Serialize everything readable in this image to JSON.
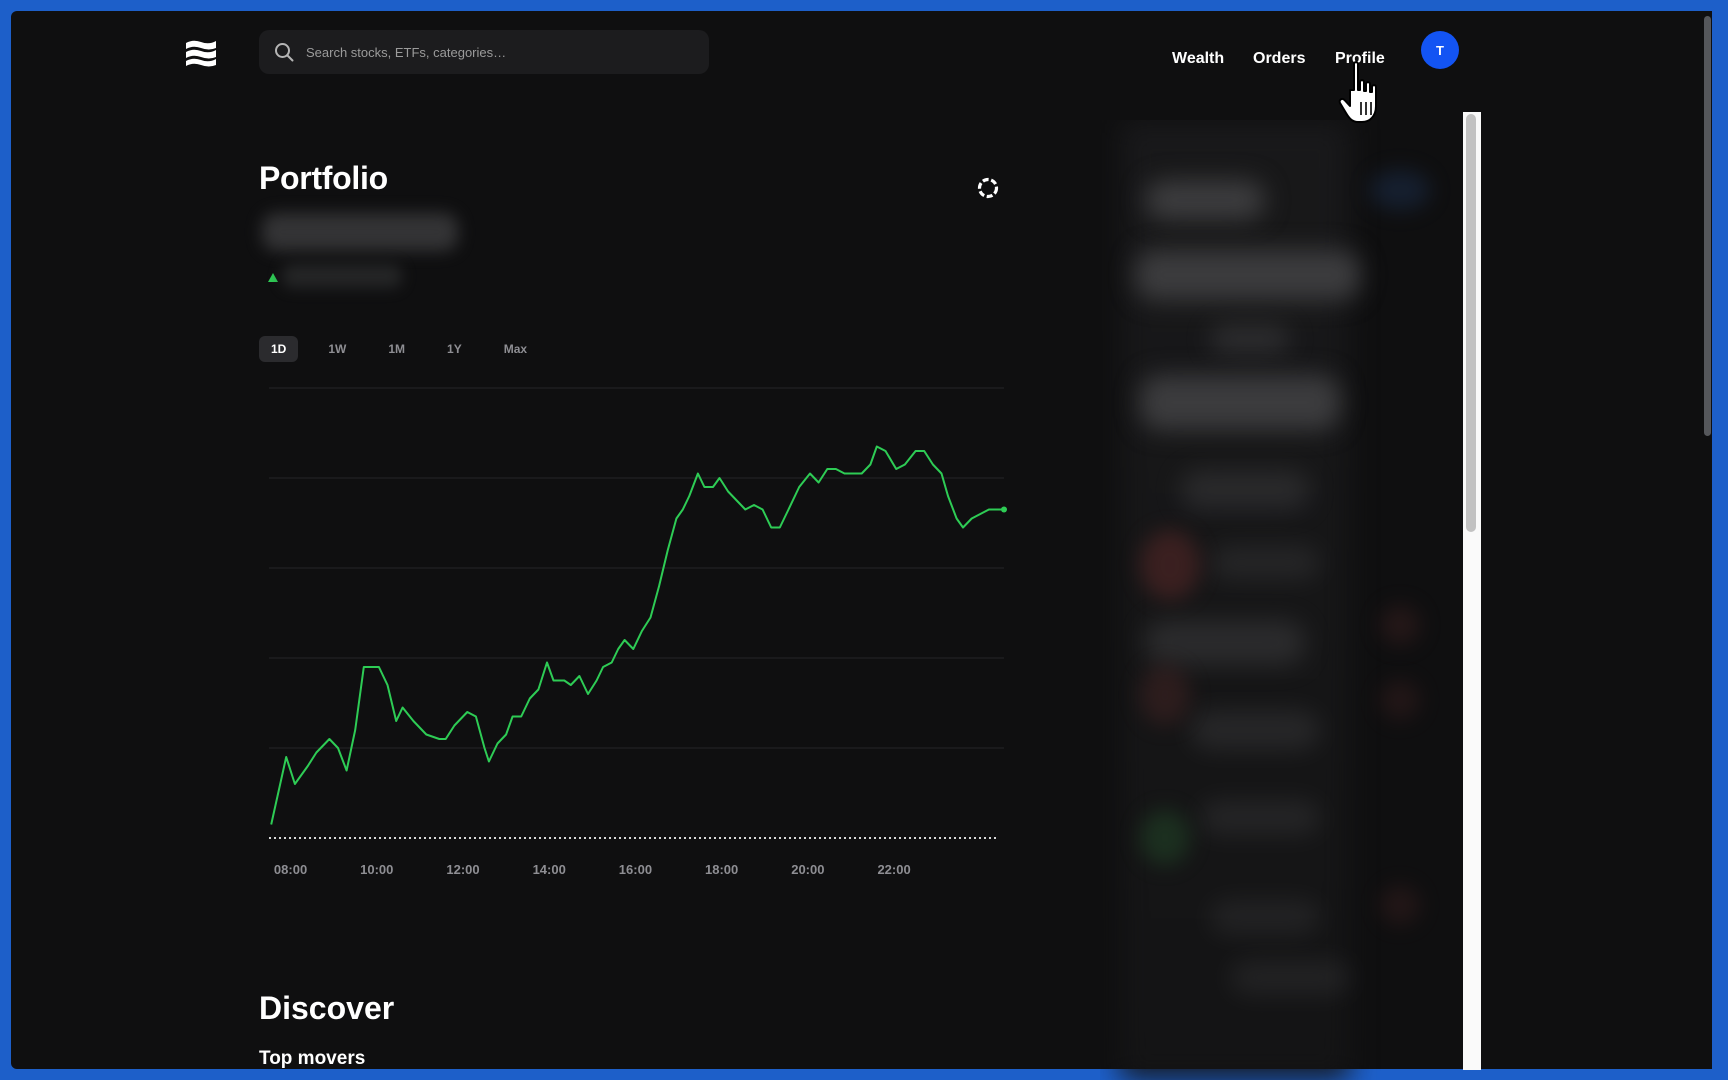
{
  "header": {
    "search_placeholder": "Search stocks, ETFs, categories…",
    "nav": [
      "Wealth",
      "Orders",
      "Profile"
    ],
    "avatar_initial": "T"
  },
  "portfolio": {
    "title": "Portfolio",
    "ranges": [
      "1D",
      "1W",
      "1M",
      "1Y",
      "Max"
    ],
    "active_range": "1D"
  },
  "chart_data": {
    "type": "line",
    "line_color": "#2ecc55",
    "x_tick_labels": [
      "08:00",
      "10:00",
      "12:00",
      "14:00",
      "16:00",
      "18:00",
      "20:00",
      "22:00"
    ],
    "x_range_hours": [
      7.5,
      23.0
    ],
    "grid": "horizontal",
    "baseline": "dotted",
    "y_normalized_note": "",
    "series": [
      {
        "values": [
          [
            7.55,
            0.03
          ],
          [
            7.9,
            0.18
          ],
          [
            8.1,
            0.12
          ],
          [
            8.4,
            0.16
          ],
          [
            8.6,
            0.19
          ],
          [
            8.9,
            0.22
          ],
          [
            9.1,
            0.2
          ],
          [
            9.3,
            0.15
          ],
          [
            9.5,
            0.24
          ],
          [
            9.7,
            0.38
          ],
          [
            10.05,
            0.38
          ],
          [
            10.25,
            0.34
          ],
          [
            10.45,
            0.26
          ],
          [
            10.6,
            0.29
          ],
          [
            10.85,
            0.26
          ],
          [
            11.15,
            0.23
          ],
          [
            11.45,
            0.22
          ],
          [
            11.6,
            0.22
          ],
          [
            11.8,
            0.25
          ],
          [
            12.1,
            0.28
          ],
          [
            12.3,
            0.27
          ],
          [
            12.5,
            0.2
          ],
          [
            12.6,
            0.17
          ],
          [
            12.8,
            0.21
          ],
          [
            13.0,
            0.23
          ],
          [
            13.15,
            0.27
          ],
          [
            13.35,
            0.27
          ],
          [
            13.55,
            0.31
          ],
          [
            13.75,
            0.33
          ],
          [
            13.95,
            0.39
          ],
          [
            14.1,
            0.35
          ],
          [
            14.35,
            0.35
          ],
          [
            14.5,
            0.34
          ],
          [
            14.7,
            0.36
          ],
          [
            14.9,
            0.32
          ],
          [
            15.1,
            0.35
          ],
          [
            15.25,
            0.38
          ],
          [
            15.45,
            0.39
          ],
          [
            15.6,
            0.42
          ],
          [
            15.75,
            0.44
          ],
          [
            15.95,
            0.42
          ],
          [
            16.15,
            0.46
          ],
          [
            16.35,
            0.49
          ],
          [
            16.55,
            0.56
          ],
          [
            16.75,
            0.64
          ],
          [
            16.95,
            0.71
          ],
          [
            17.1,
            0.73
          ],
          [
            17.25,
            0.76
          ],
          [
            17.45,
            0.81
          ],
          [
            17.6,
            0.78
          ],
          [
            17.8,
            0.78
          ],
          [
            17.95,
            0.8
          ],
          [
            18.15,
            0.77
          ],
          [
            18.35,
            0.75
          ],
          [
            18.55,
            0.73
          ],
          [
            18.75,
            0.74
          ],
          [
            18.95,
            0.73
          ],
          [
            19.15,
            0.69
          ],
          [
            19.35,
            0.69
          ],
          [
            19.55,
            0.73
          ],
          [
            19.8,
            0.78
          ],
          [
            20.05,
            0.81
          ],
          [
            20.25,
            0.79
          ],
          [
            20.45,
            0.82
          ],
          [
            20.65,
            0.82
          ],
          [
            20.85,
            0.81
          ],
          [
            21.05,
            0.81
          ],
          [
            21.25,
            0.81
          ],
          [
            21.45,
            0.83
          ],
          [
            21.6,
            0.87
          ],
          [
            21.8,
            0.86
          ],
          [
            22.05,
            0.82
          ],
          [
            22.25,
            0.83
          ],
          [
            22.5,
            0.86
          ],
          [
            22.7,
            0.86
          ],
          [
            22.9,
            0.83
          ],
          [
            23.1,
            0.81
          ],
          [
            23.25,
            0.76
          ],
          [
            23.45,
            0.71
          ],
          [
            23.6,
            0.69
          ],
          [
            23.8,
            0.71
          ],
          [
            24.0,
            0.72
          ],
          [
            24.2,
            0.73
          ],
          [
            24.35,
            0.73
          ],
          [
            24.55,
            0.73
          ]
        ]
      }
    ]
  },
  "discover": {
    "title": "Discover",
    "subtitle": "Top movers"
  }
}
